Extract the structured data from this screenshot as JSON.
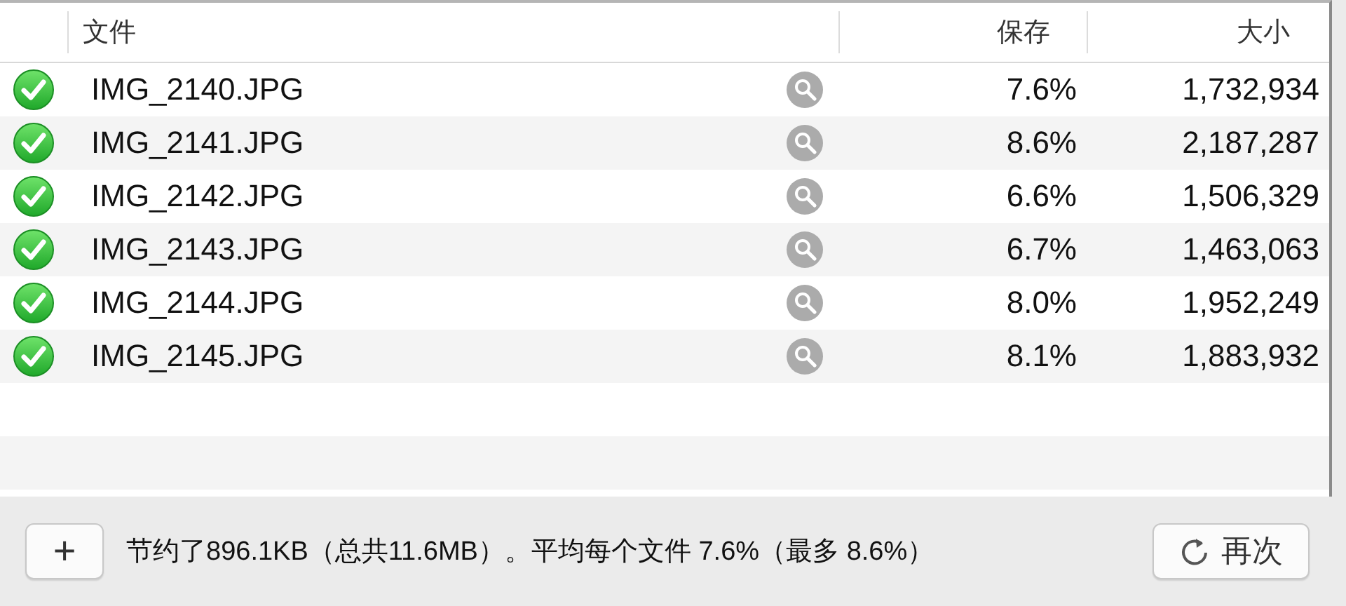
{
  "table": {
    "columns": [
      "文件",
      "保存",
      "大小"
    ],
    "rows": [
      {
        "done": true,
        "file": "IMG_2140.JPG",
        "saved": "7.6%",
        "size": "1,732,934"
      },
      {
        "done": true,
        "file": "IMG_2141.JPG",
        "saved": "8.6%",
        "size": "2,187,287"
      },
      {
        "done": true,
        "file": "IMG_2142.JPG",
        "saved": "6.6%",
        "size": "1,506,329"
      },
      {
        "done": true,
        "file": "IMG_2143.JPG",
        "saved": "6.7%",
        "size": "1,463,063"
      },
      {
        "done": true,
        "file": "IMG_2144.JPG",
        "saved": "8.0%",
        "size": "1,952,249"
      },
      {
        "done": true,
        "file": "IMG_2145.JPG",
        "saved": "8.1%",
        "size": "1,883,932"
      }
    ]
  },
  "footer": {
    "add_button": "+",
    "summary": "节约了896.1KB（总共11.6MB）。平均每个文件 7.6%（最多 8.6%）",
    "again_button": "再次"
  }
}
